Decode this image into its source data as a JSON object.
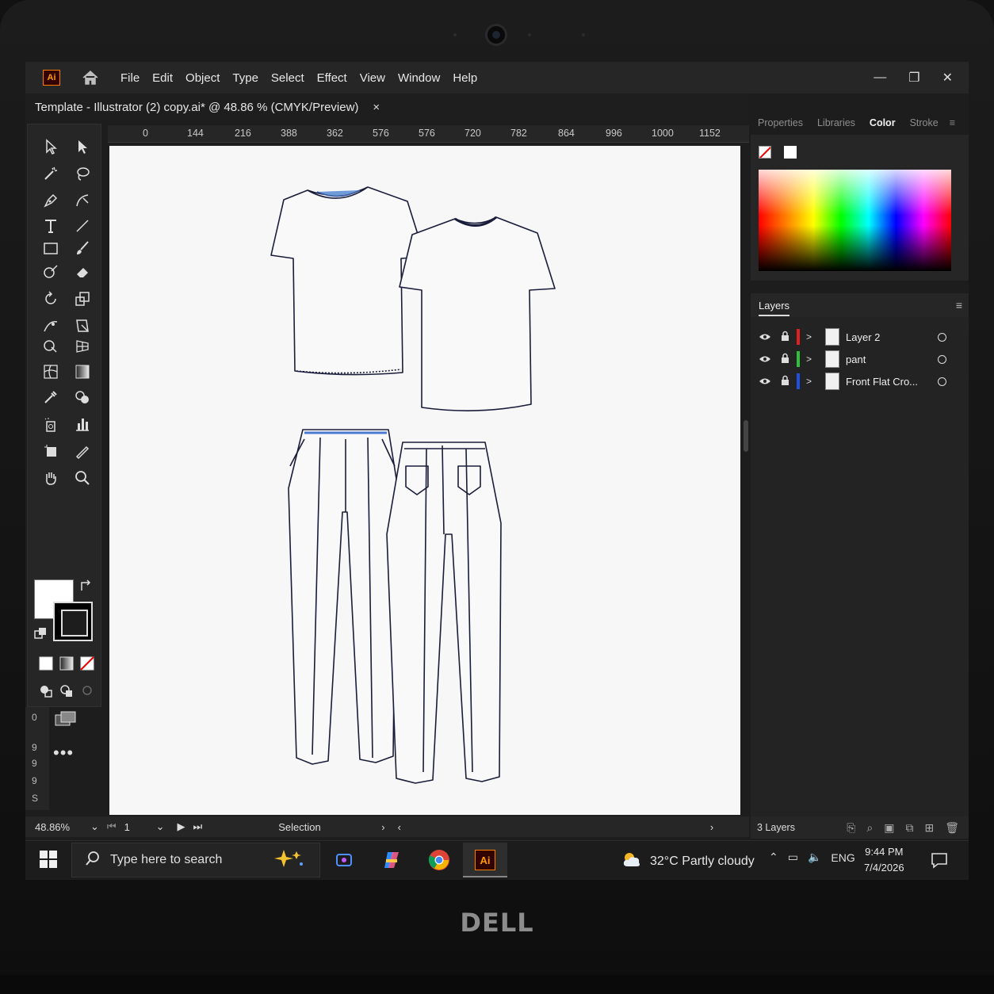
{
  "device": {
    "brand": "DELL"
  },
  "app": {
    "logo": "Ai",
    "menu": [
      "File",
      "Edit",
      "Object",
      "Type",
      "Select",
      "Effect",
      "View",
      "Window",
      "Help"
    ],
    "window_controls": {
      "minimize": "—",
      "restore": "❐",
      "close": "✕"
    }
  },
  "document_tab": {
    "title": "Template - Illustrator (2) copy.ai* @ 48.86 % (CMYK/Preview)",
    "close": "×"
  },
  "ruler": {
    "horizontal": [
      "0",
      "144",
      "216",
      "388",
      "362",
      "576",
      "576",
      "720",
      "782",
      "864",
      "996",
      "1000",
      "1152"
    ],
    "vertical": [
      "0",
      "9",
      "9",
      "9",
      "S"
    ]
  },
  "toolbar": {
    "more": "•••"
  },
  "status_bar": {
    "zoom": "48.86%",
    "artboard": "1",
    "tool": "Selection"
  },
  "panels": {
    "tabs": [
      {
        "label": "Properties",
        "active": false
      },
      {
        "label": "Libraries",
        "active": false
      },
      {
        "label": "Color",
        "active": true
      },
      {
        "label": "Stroke",
        "active": false
      }
    ],
    "layers_title": "Layers",
    "layers": [
      {
        "name": "Layer 2",
        "color": "#e02020"
      },
      {
        "name": "pant",
        "color": "#2fbf3a"
      },
      {
        "name": "Front Flat Cro...",
        "color": "#2050e0"
      }
    ],
    "layers_count": "3 Layers"
  },
  "taskbar": {
    "search_placeholder": "Type here to search",
    "weather": "32°C Partly cloudy",
    "language": "ENG",
    "time": "9:44 PM",
    "date": "7/4/2026"
  }
}
